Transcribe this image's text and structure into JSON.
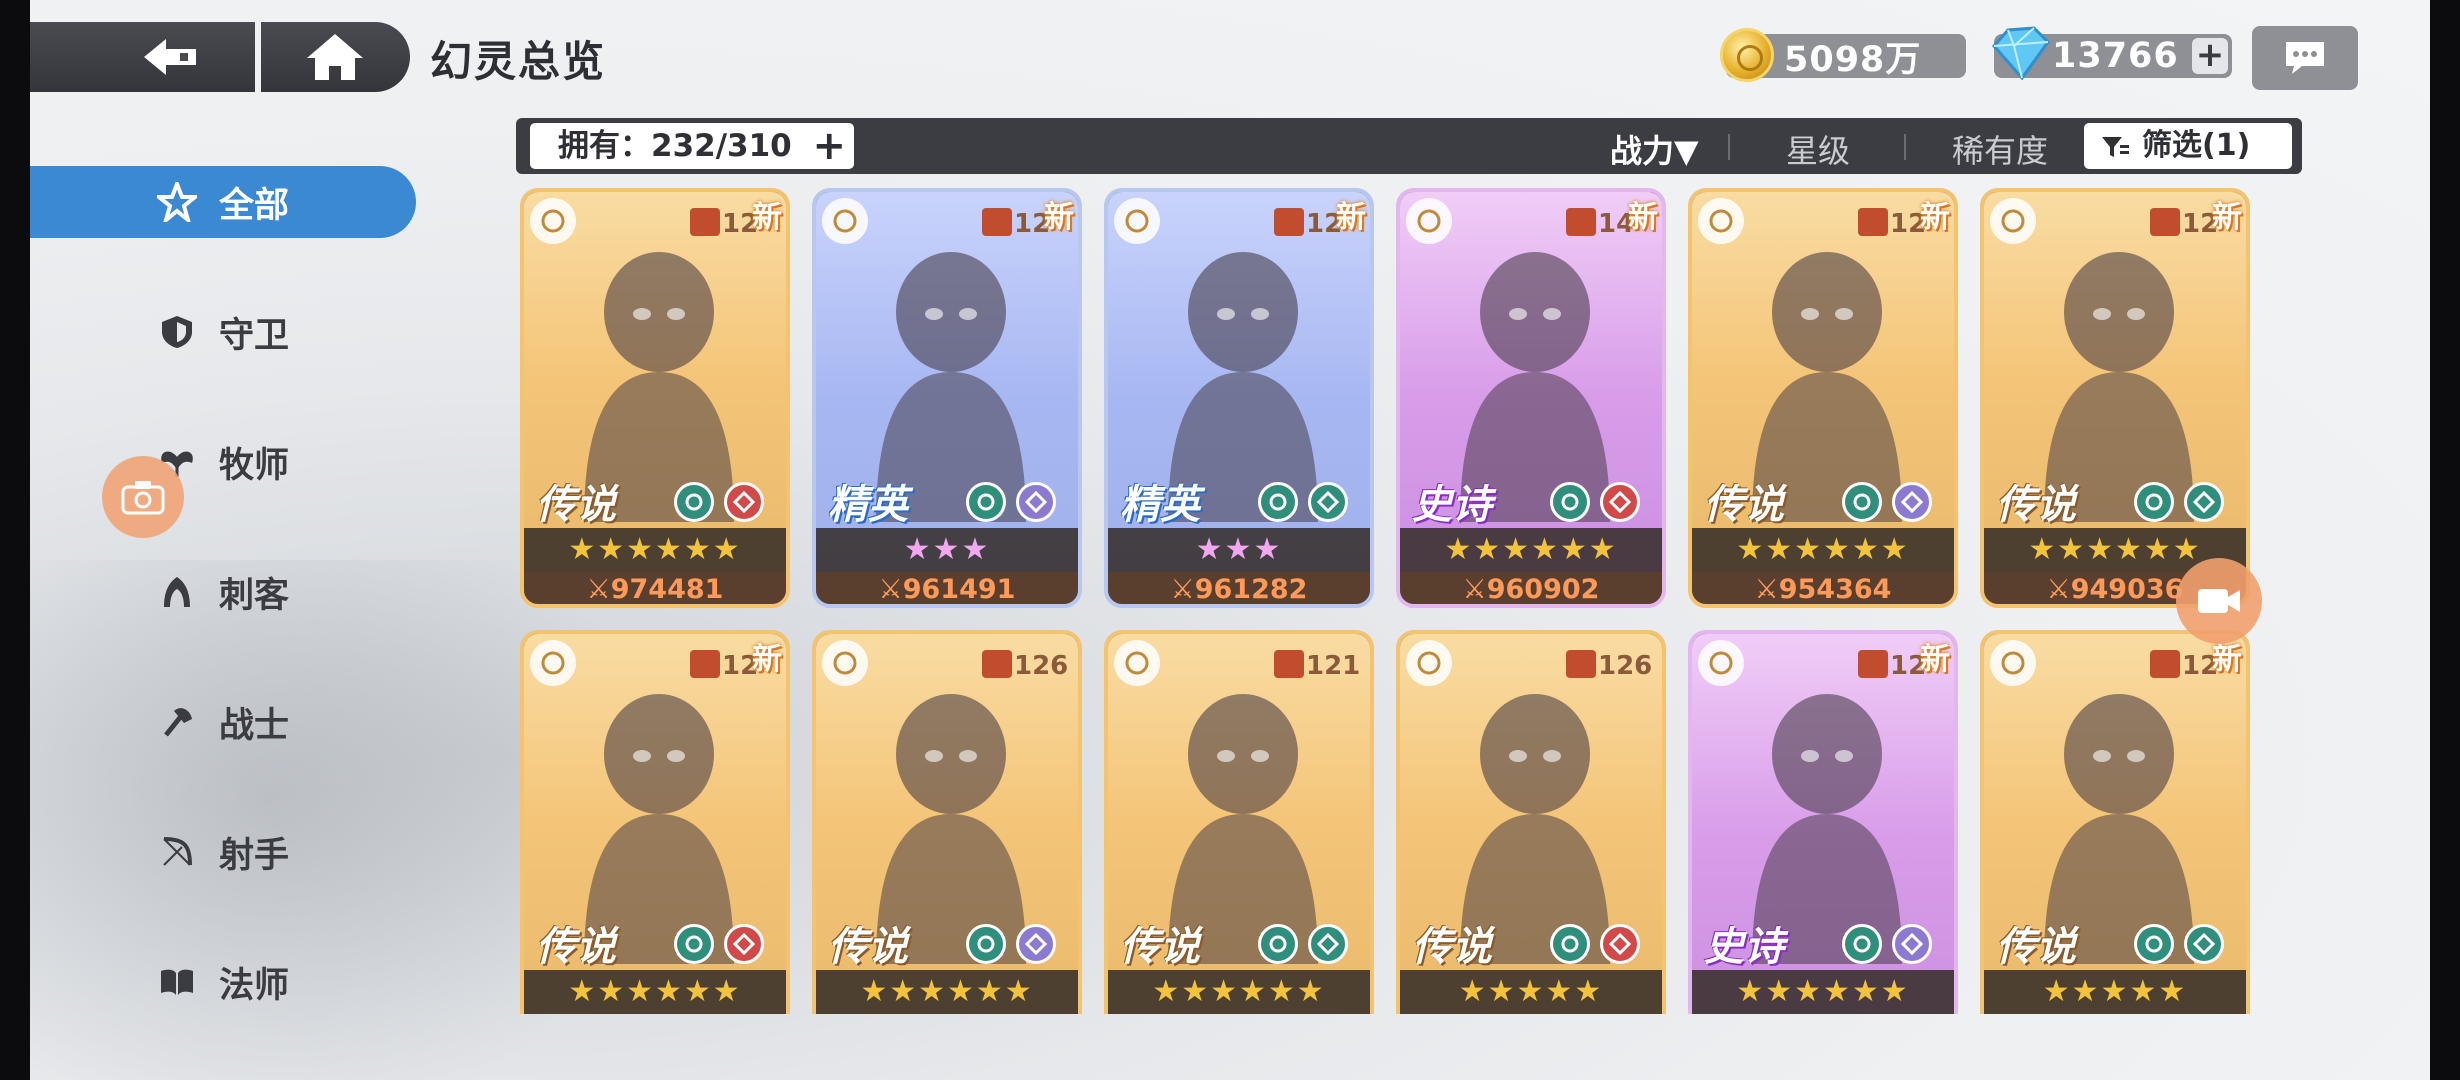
{
  "header": {
    "title": "幻灵总览"
  },
  "resources": {
    "gold": "5098万",
    "gems": "13766"
  },
  "filter_bar": {
    "owned_label": "拥有：232/310",
    "sort_power": "战力▼",
    "sort_star": "星级",
    "sort_rarity": "稀有度",
    "filter_label": "筛选(1)"
  },
  "sidebar": {
    "items": [
      {
        "label": "全部",
        "icon": "all-star-icon"
      },
      {
        "label": "守卫",
        "icon": "shield-icon"
      },
      {
        "label": "牧师",
        "icon": "priest-icon"
      },
      {
        "label": "刺客",
        "icon": "assassin-icon"
      },
      {
        "label": "战士",
        "icon": "axe-icon"
      },
      {
        "label": "射手",
        "icon": "bow-icon"
      },
      {
        "label": "法师",
        "icon": "book-icon"
      }
    ]
  },
  "cards": [
    {
      "rarity": "传说",
      "level": "12",
      "new": "新",
      "stars": "★★★★★★",
      "power": "974481",
      "theme": "legend"
    },
    {
      "rarity": "精英",
      "level": "12",
      "new": "新",
      "stars": "★★★",
      "power": "961491",
      "theme": "elite"
    },
    {
      "rarity": "精英",
      "level": "12",
      "new": "新",
      "stars": "★★★",
      "power": "961282",
      "theme": "elite"
    },
    {
      "rarity": "史诗",
      "level": "14",
      "new": "新",
      "stars": "★★★★★★",
      "power": "960902",
      "theme": "epic"
    },
    {
      "rarity": "传说",
      "level": "12",
      "new": "新",
      "stars": "★★★★★★",
      "power": "954364",
      "theme": "legend"
    },
    {
      "rarity": "传说",
      "level": "12",
      "new": "新",
      "stars": "★★★★★★",
      "power": "949036",
      "theme": "legend"
    },
    {
      "rarity": "传说",
      "level": "12",
      "new": "新",
      "stars": "★★★★★★",
      "power": "",
      "theme": "legend"
    },
    {
      "rarity": "传说",
      "level": "126",
      "new": "",
      "stars": "★★★★★★",
      "power": "",
      "theme": "legend"
    },
    {
      "rarity": "传说",
      "level": "121",
      "new": "",
      "stars": "★★★★★★",
      "power": "",
      "theme": "legend"
    },
    {
      "rarity": "传说",
      "level": "126",
      "new": "",
      "stars": "★★★★★",
      "power": "",
      "theme": "legend"
    },
    {
      "rarity": "史诗",
      "level": "12",
      "new": "新",
      "stars": "★★★★★★",
      "power": "",
      "theme": "epic"
    },
    {
      "rarity": "传说",
      "level": "12",
      "new": "新",
      "stars": "★★★★★",
      "power": "",
      "theme": "legend"
    }
  ]
}
